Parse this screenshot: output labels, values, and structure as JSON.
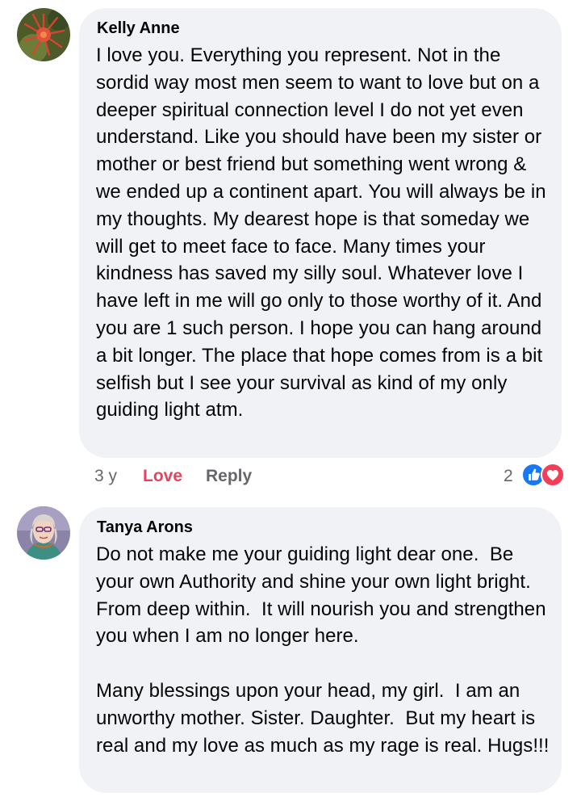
{
  "comments": [
    {
      "author": "Kelly Anne",
      "text": "I love you. Everything you represent. Not in the sordid way most men seem to want to love but on a deeper spiritual connection level I do not yet even understand. Like you should have been my sister or mother or best friend but something went wrong & we ended up a continent apart. You will always be in my thoughts. My dearest hope is that someday we will get to meet face to face. Many times your kindness has saved my silly soul. Whatever love I have left in me will go only to those worthy of it. And you are 1 such person. I hope you can hang around a bit longer. The place that hope comes from is a bit selfish but I see your survival as kind of my only guiding light atm.",
      "age": "3 y",
      "reaction_label": "Love",
      "reply_label": "Reply",
      "reaction_count": "2",
      "reaction_icons": [
        "like-icon",
        "love-icon"
      ]
    },
    {
      "author": "Tanya Arons",
      "text": "Do not make me your guiding light dear one.  Be your own Authority and shine your own light bright.  From deep within.  It will nourish you and strengthen you when I am no longer here.\n\nMany blessings upon your head, my girl.  I am an unworthy mother. Sister. Daughter.  But my heart is real and my love as much as my rage is real. Hugs!!!"
    }
  ],
  "colors": {
    "bubble": "#f0f2f5",
    "love_accent": "#e8425e",
    "like_blue": "#1877f2",
    "muted": "#65676b"
  }
}
